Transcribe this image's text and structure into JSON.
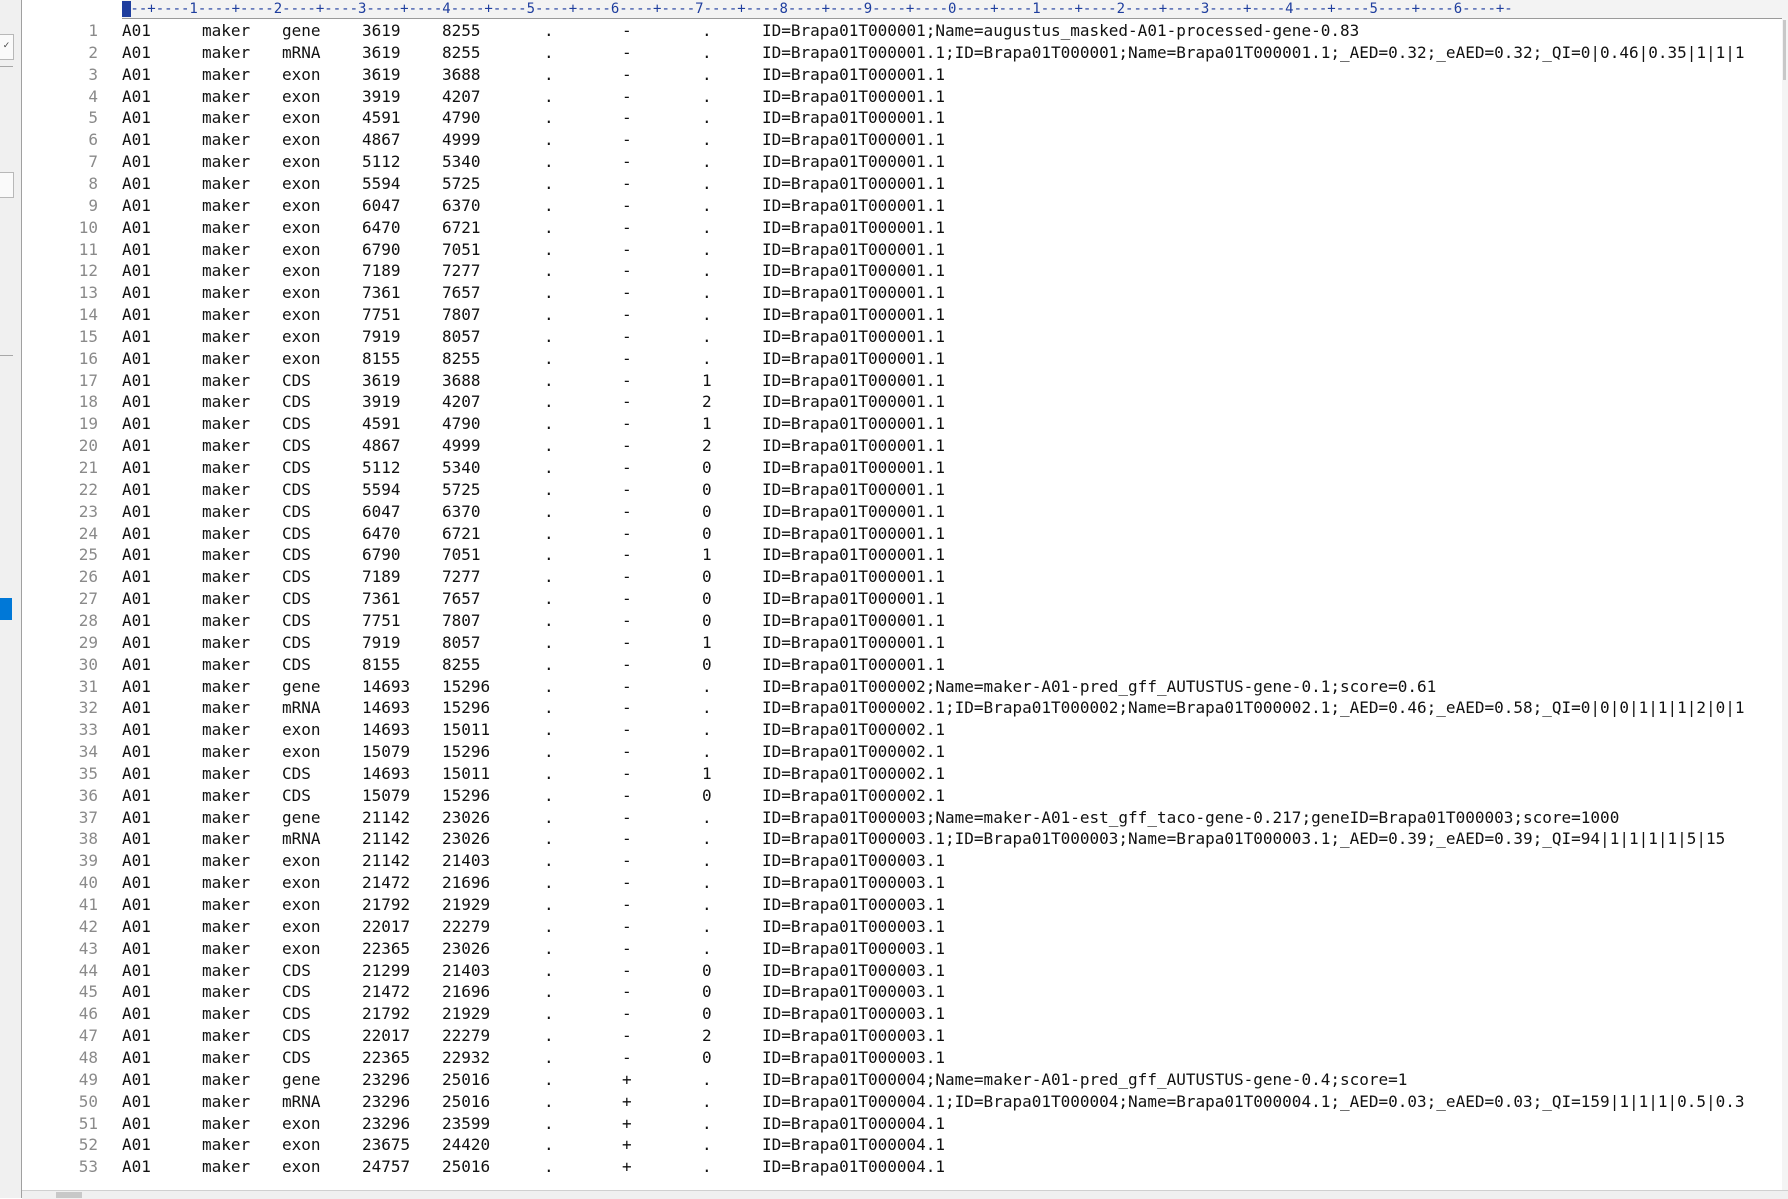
{
  "ruler": {
    "text": "---+----1----+----2----+----3----+----4----+----5----+----6----+----7----+----8----+----9----+----0----+----1----+----2----+----3----+----4----+----5----+----6----+-"
  },
  "left_strip": {
    "toggle_glyph": "✓"
  },
  "rows": [
    {
      "ln": "1",
      "seqid": "A01",
      "source": "maker",
      "type": "gene",
      "start": "3619",
      "end": "8255",
      "score": ".",
      "strand": "-",
      "phase": ".",
      "attrs": "ID=Brapa01T000001;Name=augustus_masked-A01-processed-gene-0.83"
    },
    {
      "ln": "2",
      "seqid": "A01",
      "source": "maker",
      "type": "mRNA",
      "start": "3619",
      "end": "8255",
      "score": ".",
      "strand": "-",
      "phase": ".",
      "attrs": "ID=Brapa01T000001.1;ID=Brapa01T000001;Name=Brapa01T000001.1;_AED=0.32;_eAED=0.32;_QI=0|0.46|0.35|1|1|1"
    },
    {
      "ln": "3",
      "seqid": "A01",
      "source": "maker",
      "type": "exon",
      "start": "3619",
      "end": "3688",
      "score": ".",
      "strand": "-",
      "phase": ".",
      "attrs": "ID=Brapa01T000001.1"
    },
    {
      "ln": "4",
      "seqid": "A01",
      "source": "maker",
      "type": "exon",
      "start": "3919",
      "end": "4207",
      "score": ".",
      "strand": "-",
      "phase": ".",
      "attrs": "ID=Brapa01T000001.1"
    },
    {
      "ln": "5",
      "seqid": "A01",
      "source": "maker",
      "type": "exon",
      "start": "4591",
      "end": "4790",
      "score": ".",
      "strand": "-",
      "phase": ".",
      "attrs": "ID=Brapa01T000001.1"
    },
    {
      "ln": "6",
      "seqid": "A01",
      "source": "maker",
      "type": "exon",
      "start": "4867",
      "end": "4999",
      "score": ".",
      "strand": "-",
      "phase": ".",
      "attrs": "ID=Brapa01T000001.1"
    },
    {
      "ln": "7",
      "seqid": "A01",
      "source": "maker",
      "type": "exon",
      "start": "5112",
      "end": "5340",
      "score": ".",
      "strand": "-",
      "phase": ".",
      "attrs": "ID=Brapa01T000001.1"
    },
    {
      "ln": "8",
      "seqid": "A01",
      "source": "maker",
      "type": "exon",
      "start": "5594",
      "end": "5725",
      "score": ".",
      "strand": "-",
      "phase": ".",
      "attrs": "ID=Brapa01T000001.1"
    },
    {
      "ln": "9",
      "seqid": "A01",
      "source": "maker",
      "type": "exon",
      "start": "6047",
      "end": "6370",
      "score": ".",
      "strand": "-",
      "phase": ".",
      "attrs": "ID=Brapa01T000001.1"
    },
    {
      "ln": "10",
      "seqid": "A01",
      "source": "maker",
      "type": "exon",
      "start": "6470",
      "end": "6721",
      "score": ".",
      "strand": "-",
      "phase": ".",
      "attrs": "ID=Brapa01T000001.1"
    },
    {
      "ln": "11",
      "seqid": "A01",
      "source": "maker",
      "type": "exon",
      "start": "6790",
      "end": "7051",
      "score": ".",
      "strand": "-",
      "phase": ".",
      "attrs": "ID=Brapa01T000001.1"
    },
    {
      "ln": "12",
      "seqid": "A01",
      "source": "maker",
      "type": "exon",
      "start": "7189",
      "end": "7277",
      "score": ".",
      "strand": "-",
      "phase": ".",
      "attrs": "ID=Brapa01T000001.1"
    },
    {
      "ln": "13",
      "seqid": "A01",
      "source": "maker",
      "type": "exon",
      "start": "7361",
      "end": "7657",
      "score": ".",
      "strand": "-",
      "phase": ".",
      "attrs": "ID=Brapa01T000001.1"
    },
    {
      "ln": "14",
      "seqid": "A01",
      "source": "maker",
      "type": "exon",
      "start": "7751",
      "end": "7807",
      "score": ".",
      "strand": "-",
      "phase": ".",
      "attrs": "ID=Brapa01T000001.1"
    },
    {
      "ln": "15",
      "seqid": "A01",
      "source": "maker",
      "type": "exon",
      "start": "7919",
      "end": "8057",
      "score": ".",
      "strand": "-",
      "phase": ".",
      "attrs": "ID=Brapa01T000001.1"
    },
    {
      "ln": "16",
      "seqid": "A01",
      "source": "maker",
      "type": "exon",
      "start": "8155",
      "end": "8255",
      "score": ".",
      "strand": "-",
      "phase": ".",
      "attrs": "ID=Brapa01T000001.1"
    },
    {
      "ln": "17",
      "seqid": "A01",
      "source": "maker",
      "type": "CDS",
      "start": "3619",
      "end": "3688",
      "score": ".",
      "strand": "-",
      "phase": "1",
      "attrs": "ID=Brapa01T000001.1"
    },
    {
      "ln": "18",
      "seqid": "A01",
      "source": "maker",
      "type": "CDS",
      "start": "3919",
      "end": "4207",
      "score": ".",
      "strand": "-",
      "phase": "2",
      "attrs": "ID=Brapa01T000001.1"
    },
    {
      "ln": "19",
      "seqid": "A01",
      "source": "maker",
      "type": "CDS",
      "start": "4591",
      "end": "4790",
      "score": ".",
      "strand": "-",
      "phase": "1",
      "attrs": "ID=Brapa01T000001.1"
    },
    {
      "ln": "20",
      "seqid": "A01",
      "source": "maker",
      "type": "CDS",
      "start": "4867",
      "end": "4999",
      "score": ".",
      "strand": "-",
      "phase": "2",
      "attrs": "ID=Brapa01T000001.1"
    },
    {
      "ln": "21",
      "seqid": "A01",
      "source": "maker",
      "type": "CDS",
      "start": "5112",
      "end": "5340",
      "score": ".",
      "strand": "-",
      "phase": "0",
      "attrs": "ID=Brapa01T000001.1"
    },
    {
      "ln": "22",
      "seqid": "A01",
      "source": "maker",
      "type": "CDS",
      "start": "5594",
      "end": "5725",
      "score": ".",
      "strand": "-",
      "phase": "0",
      "attrs": "ID=Brapa01T000001.1"
    },
    {
      "ln": "23",
      "seqid": "A01",
      "source": "maker",
      "type": "CDS",
      "start": "6047",
      "end": "6370",
      "score": ".",
      "strand": "-",
      "phase": "0",
      "attrs": "ID=Brapa01T000001.1"
    },
    {
      "ln": "24",
      "seqid": "A01",
      "source": "maker",
      "type": "CDS",
      "start": "6470",
      "end": "6721",
      "score": ".",
      "strand": "-",
      "phase": "0",
      "attrs": "ID=Brapa01T000001.1"
    },
    {
      "ln": "25",
      "seqid": "A01",
      "source": "maker",
      "type": "CDS",
      "start": "6790",
      "end": "7051",
      "score": ".",
      "strand": "-",
      "phase": "1",
      "attrs": "ID=Brapa01T000001.1"
    },
    {
      "ln": "26",
      "seqid": "A01",
      "source": "maker",
      "type": "CDS",
      "start": "7189",
      "end": "7277",
      "score": ".",
      "strand": "-",
      "phase": "0",
      "attrs": "ID=Brapa01T000001.1"
    },
    {
      "ln": "27",
      "seqid": "A01",
      "source": "maker",
      "type": "CDS",
      "start": "7361",
      "end": "7657",
      "score": ".",
      "strand": "-",
      "phase": "0",
      "attrs": "ID=Brapa01T000001.1"
    },
    {
      "ln": "28",
      "seqid": "A01",
      "source": "maker",
      "type": "CDS",
      "start": "7751",
      "end": "7807",
      "score": ".",
      "strand": "-",
      "phase": "0",
      "attrs": "ID=Brapa01T000001.1"
    },
    {
      "ln": "29",
      "seqid": "A01",
      "source": "maker",
      "type": "CDS",
      "start": "7919",
      "end": "8057",
      "score": ".",
      "strand": "-",
      "phase": "1",
      "attrs": "ID=Brapa01T000001.1"
    },
    {
      "ln": "30",
      "seqid": "A01",
      "source": "maker",
      "type": "CDS",
      "start": "8155",
      "end": "8255",
      "score": ".",
      "strand": "-",
      "phase": "0",
      "attrs": "ID=Brapa01T000001.1"
    },
    {
      "ln": "31",
      "seqid": "A01",
      "source": "maker",
      "type": "gene",
      "start": "14693",
      "end": "15296",
      "score": ".",
      "strand": "-",
      "phase": ".",
      "attrs": "ID=Brapa01T000002;Name=maker-A01-pred_gff_AUTUSTUS-gene-0.1;score=0.61"
    },
    {
      "ln": "32",
      "seqid": "A01",
      "source": "maker",
      "type": "mRNA",
      "start": "14693",
      "end": "15296",
      "score": ".",
      "strand": "-",
      "phase": ".",
      "attrs": "ID=Brapa01T000002.1;ID=Brapa01T000002;Name=Brapa01T000002.1;_AED=0.46;_eAED=0.58;_QI=0|0|0|1|1|1|2|0|1"
    },
    {
      "ln": "33",
      "seqid": "A01",
      "source": "maker",
      "type": "exon",
      "start": "14693",
      "end": "15011",
      "score": ".",
      "strand": "-",
      "phase": ".",
      "attrs": "ID=Brapa01T000002.1"
    },
    {
      "ln": "34",
      "seqid": "A01",
      "source": "maker",
      "type": "exon",
      "start": "15079",
      "end": "15296",
      "score": ".",
      "strand": "-",
      "phase": ".",
      "attrs": "ID=Brapa01T000002.1"
    },
    {
      "ln": "35",
      "seqid": "A01",
      "source": "maker",
      "type": "CDS",
      "start": "14693",
      "end": "15011",
      "score": ".",
      "strand": "-",
      "phase": "1",
      "attrs": "ID=Brapa01T000002.1"
    },
    {
      "ln": "36",
      "seqid": "A01",
      "source": "maker",
      "type": "CDS",
      "start": "15079",
      "end": "15296",
      "score": ".",
      "strand": "-",
      "phase": "0",
      "attrs": "ID=Brapa01T000002.1"
    },
    {
      "ln": "37",
      "seqid": "A01",
      "source": "maker",
      "type": "gene",
      "start": "21142",
      "end": "23026",
      "score": ".",
      "strand": "-",
      "phase": ".",
      "attrs": "ID=Brapa01T000003;Name=maker-A01-est_gff_taco-gene-0.217;geneID=Brapa01T000003;score=1000"
    },
    {
      "ln": "38",
      "seqid": "A01",
      "source": "maker",
      "type": "mRNA",
      "start": "21142",
      "end": "23026",
      "score": ".",
      "strand": "-",
      "phase": ".",
      "attrs": "ID=Brapa01T000003.1;ID=Brapa01T000003;Name=Brapa01T000003.1;_AED=0.39;_eAED=0.39;_QI=94|1|1|1|1|5|15"
    },
    {
      "ln": "39",
      "seqid": "A01",
      "source": "maker",
      "type": "exon",
      "start": "21142",
      "end": "21403",
      "score": ".",
      "strand": "-",
      "phase": ".",
      "attrs": "ID=Brapa01T000003.1"
    },
    {
      "ln": "40",
      "seqid": "A01",
      "source": "maker",
      "type": "exon",
      "start": "21472",
      "end": "21696",
      "score": ".",
      "strand": "-",
      "phase": ".",
      "attrs": "ID=Brapa01T000003.1"
    },
    {
      "ln": "41",
      "seqid": "A01",
      "source": "maker",
      "type": "exon",
      "start": "21792",
      "end": "21929",
      "score": ".",
      "strand": "-",
      "phase": ".",
      "attrs": "ID=Brapa01T000003.1"
    },
    {
      "ln": "42",
      "seqid": "A01",
      "source": "maker",
      "type": "exon",
      "start": "22017",
      "end": "22279",
      "score": ".",
      "strand": "-",
      "phase": ".",
      "attrs": "ID=Brapa01T000003.1"
    },
    {
      "ln": "43",
      "seqid": "A01",
      "source": "maker",
      "type": "exon",
      "start": "22365",
      "end": "23026",
      "score": ".",
      "strand": "-",
      "phase": ".",
      "attrs": "ID=Brapa01T000003.1"
    },
    {
      "ln": "44",
      "seqid": "A01",
      "source": "maker",
      "type": "CDS",
      "start": "21299",
      "end": "21403",
      "score": ".",
      "strand": "-",
      "phase": "0",
      "attrs": "ID=Brapa01T000003.1"
    },
    {
      "ln": "45",
      "seqid": "A01",
      "source": "maker",
      "type": "CDS",
      "start": "21472",
      "end": "21696",
      "score": ".",
      "strand": "-",
      "phase": "0",
      "attrs": "ID=Brapa01T000003.1"
    },
    {
      "ln": "46",
      "seqid": "A01",
      "source": "maker",
      "type": "CDS",
      "start": "21792",
      "end": "21929",
      "score": ".",
      "strand": "-",
      "phase": "0",
      "attrs": "ID=Brapa01T000003.1"
    },
    {
      "ln": "47",
      "seqid": "A01",
      "source": "maker",
      "type": "CDS",
      "start": "22017",
      "end": "22279",
      "score": ".",
      "strand": "-",
      "phase": "2",
      "attrs": "ID=Brapa01T000003.1"
    },
    {
      "ln": "48",
      "seqid": "A01",
      "source": "maker",
      "type": "CDS",
      "start": "22365",
      "end": "22932",
      "score": ".",
      "strand": "-",
      "phase": "0",
      "attrs": "ID=Brapa01T000003.1"
    },
    {
      "ln": "49",
      "seqid": "A01",
      "source": "maker",
      "type": "gene",
      "start": "23296",
      "end": "25016",
      "score": ".",
      "strand": "+",
      "phase": ".",
      "attrs": "ID=Brapa01T000004;Name=maker-A01-pred_gff_AUTUSTUS-gene-0.4;score=1"
    },
    {
      "ln": "50",
      "seqid": "A01",
      "source": "maker",
      "type": "mRNA",
      "start": "23296",
      "end": "25016",
      "score": ".",
      "strand": "+",
      "phase": ".",
      "attrs": "ID=Brapa01T000004.1;ID=Brapa01T000004;Name=Brapa01T000004.1;_AED=0.03;_eAED=0.03;_QI=159|1|1|1|0.5|0.3"
    },
    {
      "ln": "51",
      "seqid": "A01",
      "source": "maker",
      "type": "exon",
      "start": "23296",
      "end": "23599",
      "score": ".",
      "strand": "+",
      "phase": ".",
      "attrs": "ID=Brapa01T000004.1"
    },
    {
      "ln": "52",
      "seqid": "A01",
      "source": "maker",
      "type": "exon",
      "start": "23675",
      "end": "24420",
      "score": ".",
      "strand": "+",
      "phase": ".",
      "attrs": "ID=Brapa01T000004.1"
    },
    {
      "ln": "53",
      "seqid": "A01",
      "source": "maker",
      "type": "exon",
      "start": "24757",
      "end": "25016",
      "score": ".",
      "strand": "+",
      "phase": ".",
      "attrs": "ID=Brapa01T000004.1"
    }
  ]
}
